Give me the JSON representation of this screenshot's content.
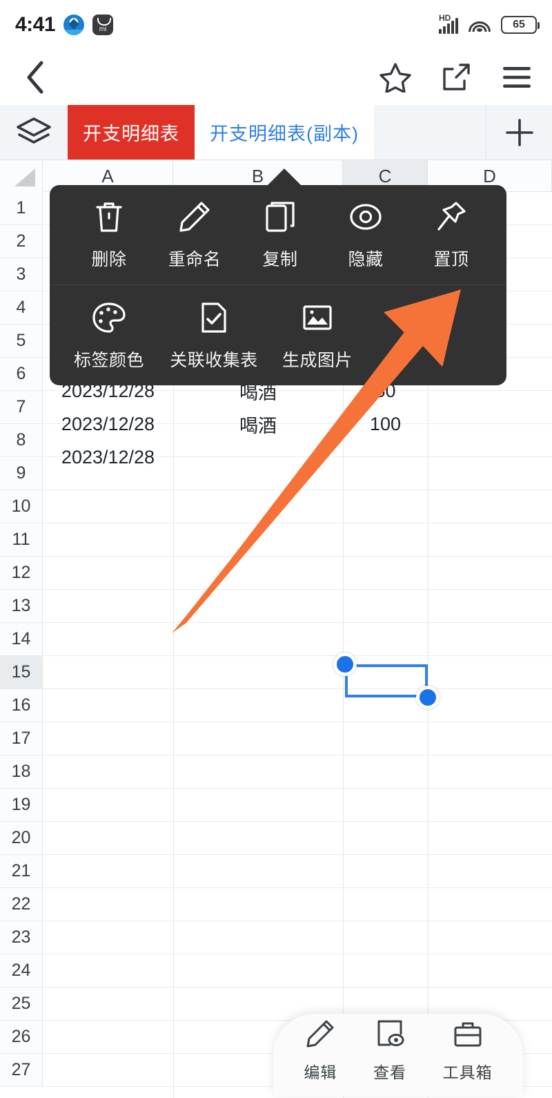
{
  "status_bar": {
    "time": "4:41",
    "battery_level": "65",
    "icons": [
      "ccb-bank-app-icon",
      "mi-store-icon",
      "hd-signal-icon",
      "wifi-icon",
      "battery-icon"
    ],
    "network_label": "HD"
  },
  "nav_bar": {
    "back_icon": "chevron-left-icon",
    "favorite_icon": "star-icon",
    "share_icon": "share-icon",
    "menu_icon": "hamburger-menu-icon"
  },
  "tab_bar": {
    "layers_icon": "layers-icon",
    "add_icon": "plus-icon",
    "tabs": [
      {
        "label": "开支明细表",
        "active": true
      },
      {
        "label": "开支明细表(副本)",
        "active": false
      }
    ],
    "active_color": "#e03127",
    "inactive_color": "#2f7fe0"
  },
  "context_menu": {
    "rows": [
      [
        {
          "label": "删除",
          "icon": "trash-icon"
        },
        {
          "label": "重命名",
          "icon": "pencil-icon"
        },
        {
          "label": "复制",
          "icon": "copy-icon"
        },
        {
          "label": "隐藏",
          "icon": "eye-icon"
        },
        {
          "label": "置顶",
          "icon": "pin-icon"
        }
      ],
      [
        {
          "label": "标签颜色",
          "icon": "palette-icon"
        },
        {
          "label": "关联收集表",
          "icon": "form-check-icon"
        },
        {
          "label": "生成图片",
          "icon": "image-icon"
        }
      ]
    ],
    "background_color": "#323232"
  },
  "annotation": {
    "type": "pointer-arrow",
    "color": "#f57338",
    "points_to": "置顶"
  },
  "spreadsheet": {
    "columns": [
      "A",
      "B",
      "C",
      "D"
    ],
    "selected_column": "C",
    "selected_row": "15",
    "rows": [
      "1",
      "2",
      "3",
      "4",
      "5",
      "6",
      "7",
      "8",
      "9",
      "10",
      "11",
      "12",
      "13",
      "14",
      "15",
      "16",
      "17",
      "18",
      "19",
      "20",
      "21",
      "22",
      "23",
      "24",
      "25",
      "26",
      "27"
    ],
    "cells": [
      {
        "row": "6",
        "col": "A",
        "value": "2023/12/28"
      },
      {
        "row": "6",
        "col": "B",
        "value": "喝酒"
      },
      {
        "row": "6",
        "col": "C",
        "value": "50"
      },
      {
        "row": "7",
        "col": "A",
        "value": "2023/12/28"
      },
      {
        "row": "7",
        "col": "B",
        "value": "喝酒"
      },
      {
        "row": "7",
        "col": "C",
        "value": "100"
      },
      {
        "row": "8",
        "col": "A",
        "value": "2023/12/28"
      },
      {
        "row": "8",
        "col": "B",
        "value": ""
      },
      {
        "row": "8",
        "col": "C",
        "value": ""
      }
    ],
    "selection": {
      "anchor_cell": "C15",
      "handle_color": "#1a73e8"
    }
  },
  "bottom_toolbar": {
    "items": [
      {
        "label": "编辑",
        "icon": "pencil-edit-icon"
      },
      {
        "label": "查看",
        "icon": "view-eye-icon"
      },
      {
        "label": "工具箱",
        "icon": "toolbox-icon"
      }
    ]
  }
}
